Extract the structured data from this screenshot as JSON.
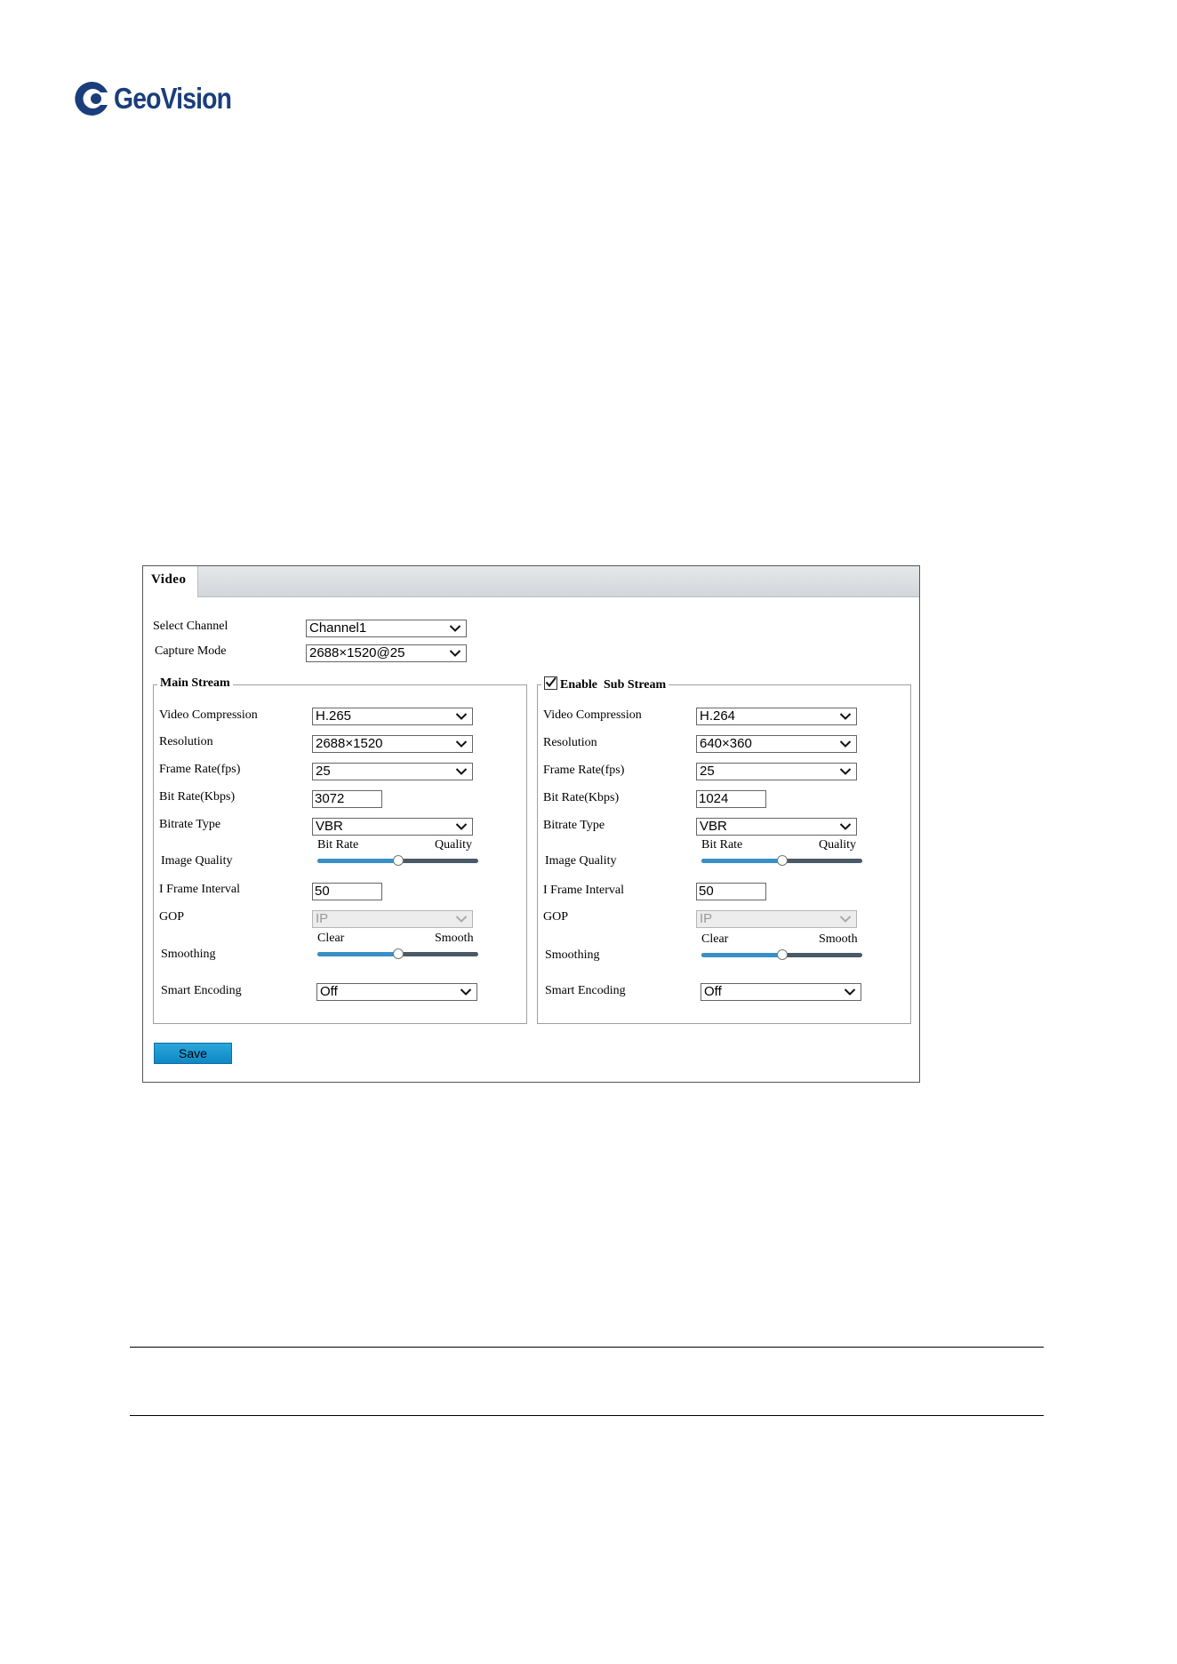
{
  "brand": {
    "name": "GeoVision",
    "color": "#1a3e7c"
  },
  "panel": {
    "tab": "Video",
    "select_channel": {
      "label": "Select Channel",
      "value": "Channel1"
    },
    "capture_mode": {
      "label": "Capture Mode",
      "value": "2688×1520@25"
    },
    "main": {
      "legend": "Main Stream",
      "video_compression": {
        "label": "Video Compression",
        "value": "H.265"
      },
      "resolution": {
        "label": "Resolution",
        "value": "2688×1520"
      },
      "frame_rate": {
        "label": "Frame Rate(fps)",
        "value": "25"
      },
      "bit_rate": {
        "label": "Bit Rate(Kbps)",
        "value": "3072"
      },
      "bitrate_type": {
        "label": "Bitrate Type",
        "value": "VBR"
      },
      "image_quality": {
        "label": "Image Quality",
        "left": "Bit Rate",
        "right": "Quality",
        "level": 0.5
      },
      "iframe": {
        "label": "I Frame Interval",
        "value": "50"
      },
      "gop": {
        "label": "GOP",
        "value": "IP"
      },
      "smoothing": {
        "label": "Smoothing",
        "left": "Clear",
        "right": "Smooth",
        "level": 0.5
      },
      "smart_encoding": {
        "label": "Smart Encoding",
        "value": "Off"
      }
    },
    "sub": {
      "legend": "Enable  Sub Stream",
      "enabled": true,
      "video_compression": {
        "label": "Video Compression",
        "value": "H.264"
      },
      "resolution": {
        "label": "Resolution",
        "value": "640×360"
      },
      "frame_rate": {
        "label": "Frame Rate(fps)",
        "value": "25"
      },
      "bit_rate": {
        "label": "Bit Rate(Kbps)",
        "value": "1024"
      },
      "bitrate_type": {
        "label": "Bitrate Type",
        "value": "VBR"
      },
      "image_quality": {
        "label": "Image Quality",
        "left": "Bit Rate",
        "right": "Quality",
        "level": 0.5
      },
      "iframe": {
        "label": "I Frame Interval",
        "value": "50"
      },
      "gop": {
        "label": "GOP",
        "value": "IP"
      },
      "smoothing": {
        "label": "Smoothing",
        "left": "Clear",
        "right": "Smooth",
        "level": 0.5
      },
      "smart_encoding": {
        "label": "Smart Encoding",
        "value": "Off"
      }
    },
    "save_label": "Save"
  }
}
